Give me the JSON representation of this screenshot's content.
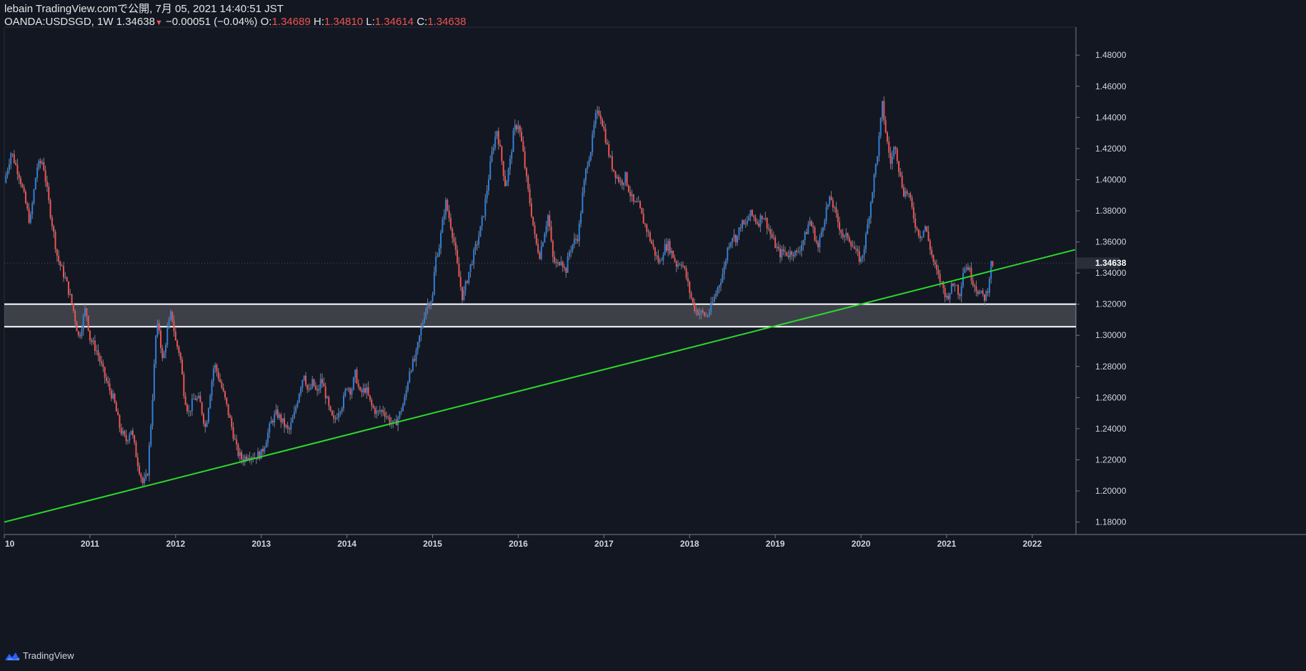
{
  "header": {
    "line1": "lebain TradingView.comで公開, 7月 05, 2021 14:40:51 JST",
    "symbol": "OANDA:USDSGD, 1W",
    "last": "1.34638",
    "change": "−0.00051 (−0.04%)",
    "o_label": "O:",
    "o_val": "1.34689",
    "h_label": "H:",
    "h_val": "1.34810",
    "l_label": "L:",
    "l_val": "1.34614",
    "c_label": "C:",
    "c_val": "1.34638"
  },
  "footer": {
    "brand": "TradingView"
  },
  "colors": {
    "up": "#2f7fd8",
    "down": "#ef5350",
    "trendline": "#2bd92b",
    "zone": "#ffffff",
    "background": "#131722"
  },
  "chart_data": {
    "type": "candlestick",
    "symbol": "OANDA:USDSGD",
    "interval": "1W",
    "y_ticks": [
      "1.18000",
      "1.20000",
      "1.22000",
      "1.24000",
      "1.26000",
      "1.28000",
      "1.30000",
      "1.32000",
      "1.34000",
      "1.36000",
      "1.38000",
      "1.40000",
      "1.42000",
      "1.44000",
      "1.46000",
      "1.48000"
    ],
    "ylim": [
      1.172,
      1.498
    ],
    "x_ticks": [
      "10",
      "2011",
      "2012",
      "2013",
      "2014",
      "2015",
      "2016",
      "2017",
      "2018",
      "2019",
      "2020",
      "2021",
      "2022"
    ],
    "x_tick_years": [
      2010.0,
      2011.0,
      2012.0,
      2013.0,
      2014.0,
      2015.0,
      2016.0,
      2017.0,
      2018.0,
      2019.0,
      2020.0,
      2021.0,
      2022.0
    ],
    "xlim": [
      2010.0,
      2022.51
    ],
    "price_label": "1.34638",
    "current_price": 1.34638,
    "zone": {
      "lower": 1.3055,
      "upper": 1.32
    },
    "trendline": [
      [
        2010.0,
        1.18
      ],
      [
        2022.5,
        1.355
      ]
    ],
    "close_path": [
      [
        2010.0,
        1.398
      ],
      [
        2010.08,
        1.418
      ],
      [
        2010.18,
        1.402
      ],
      [
        2010.3,
        1.372
      ],
      [
        2010.38,
        1.408
      ],
      [
        2010.45,
        1.412
      ],
      [
        2010.52,
        1.385
      ],
      [
        2010.62,
        1.35
      ],
      [
        2010.72,
        1.335
      ],
      [
        2010.8,
        1.318
      ],
      [
        2010.87,
        1.298
      ],
      [
        2010.95,
        1.318
      ],
      [
        2011.0,
        1.298
      ],
      [
        2011.08,
        1.29
      ],
      [
        2011.18,
        1.272
      ],
      [
        2011.28,
        1.258
      ],
      [
        2011.35,
        1.24
      ],
      [
        2011.42,
        1.232
      ],
      [
        2011.48,
        1.24
      ],
      [
        2011.55,
        1.22
      ],
      [
        2011.62,
        1.204
      ],
      [
        2011.67,
        1.21
      ],
      [
        2011.72,
        1.25
      ],
      [
        2011.77,
        1.3
      ],
      [
        2011.8,
        1.308
      ],
      [
        2011.85,
        1.282
      ],
      [
        2011.9,
        1.302
      ],
      [
        2011.95,
        1.315
      ],
      [
        2012.0,
        1.296
      ],
      [
        2012.05,
        1.288
      ],
      [
        2012.1,
        1.262
      ],
      [
        2012.15,
        1.25
      ],
      [
        2012.22,
        1.26
      ],
      [
        2012.28,
        1.258
      ],
      [
        2012.35,
        1.24
      ],
      [
        2012.4,
        1.262
      ],
      [
        2012.45,
        1.282
      ],
      [
        2012.52,
        1.27
      ],
      [
        2012.58,
        1.258
      ],
      [
        2012.65,
        1.242
      ],
      [
        2012.72,
        1.225
      ],
      [
        2012.78,
        1.22
      ],
      [
        2012.85,
        1.224
      ],
      [
        2012.92,
        1.222
      ],
      [
        2013.0,
        1.224
      ],
      [
        2013.05,
        1.232
      ],
      [
        2013.12,
        1.245
      ],
      [
        2013.18,
        1.25
      ],
      [
        2013.25,
        1.244
      ],
      [
        2013.32,
        1.238
      ],
      [
        2013.38,
        1.248
      ],
      [
        2013.45,
        1.266
      ],
      [
        2013.5,
        1.276
      ],
      [
        2013.55,
        1.262
      ],
      [
        2013.6,
        1.27
      ],
      [
        2013.65,
        1.262
      ],
      [
        2013.7,
        1.272
      ],
      [
        2013.75,
        1.262
      ],
      [
        2013.8,
        1.25
      ],
      [
        2013.85,
        1.244
      ],
      [
        2013.9,
        1.252
      ],
      [
        2013.95,
        1.256
      ],
      [
        2014.0,
        1.268
      ],
      [
        2014.05,
        1.264
      ],
      [
        2014.1,
        1.276
      ],
      [
        2014.15,
        1.262
      ],
      [
        2014.22,
        1.266
      ],
      [
        2014.28,
        1.255
      ],
      [
        2014.35,
        1.25
      ],
      [
        2014.42,
        1.252
      ],
      [
        2014.5,
        1.245
      ],
      [
        2014.55,
        1.242
      ],
      [
        2014.62,
        1.25
      ],
      [
        2014.68,
        1.26
      ],
      [
        2014.73,
        1.278
      ],
      [
        2014.8,
        1.285
      ],
      [
        2014.85,
        1.3
      ],
      [
        2014.92,
        1.318
      ],
      [
        2015.0,
        1.325
      ],
      [
        2015.03,
        1.348
      ],
      [
        2015.08,
        1.358
      ],
      [
        2015.15,
        1.386
      ],
      [
        2015.2,
        1.374
      ],
      [
        2015.25,
        1.36
      ],
      [
        2015.3,
        1.34
      ],
      [
        2015.35,
        1.324
      ],
      [
        2015.42,
        1.34
      ],
      [
        2015.48,
        1.352
      ],
      [
        2015.55,
        1.366
      ],
      [
        2015.6,
        1.38
      ],
      [
        2015.65,
        1.4
      ],
      [
        2015.7,
        1.42
      ],
      [
        2015.75,
        1.432
      ],
      [
        2015.8,
        1.415
      ],
      [
        2015.85,
        1.396
      ],
      [
        2015.9,
        1.41
      ],
      [
        2015.95,
        1.432
      ],
      [
        2016.0,
        1.436
      ],
      [
        2016.05,
        1.42
      ],
      [
        2016.1,
        1.398
      ],
      [
        2016.15,
        1.38
      ],
      [
        2016.2,
        1.36
      ],
      [
        2016.25,
        1.352
      ],
      [
        2016.3,
        1.365
      ],
      [
        2016.35,
        1.378
      ],
      [
        2016.4,
        1.35
      ],
      [
        2016.45,
        1.344
      ],
      [
        2016.5,
        1.35
      ],
      [
        2016.55,
        1.34
      ],
      [
        2016.6,
        1.355
      ],
      [
        2016.65,
        1.36
      ],
      [
        2016.7,
        1.364
      ],
      [
        2016.75,
        1.39
      ],
      [
        2016.8,
        1.41
      ],
      [
        2016.85,
        1.42
      ],
      [
        2016.9,
        1.44
      ],
      [
        2016.95,
        1.444
      ],
      [
        2017.0,
        1.432
      ],
      [
        2017.05,
        1.418
      ],
      [
        2017.1,
        1.408
      ],
      [
        2017.15,
        1.402
      ],
      [
        2017.2,
        1.398
      ],
      [
        2017.25,
        1.402
      ],
      [
        2017.3,
        1.392
      ],
      [
        2017.35,
        1.384
      ],
      [
        2017.4,
        1.384
      ],
      [
        2017.45,
        1.375
      ],
      [
        2017.5,
        1.368
      ],
      [
        2017.55,
        1.36
      ],
      [
        2017.6,
        1.352
      ],
      [
        2017.65,
        1.346
      ],
      [
        2017.7,
        1.356
      ],
      [
        2017.75,
        1.358
      ],
      [
        2017.8,
        1.352
      ],
      [
        2017.85,
        1.345
      ],
      [
        2017.9,
        1.348
      ],
      [
        2017.95,
        1.34
      ],
      [
        2018.0,
        1.328
      ],
      [
        2018.05,
        1.318
      ],
      [
        2018.1,
        1.315
      ],
      [
        2018.15,
        1.314
      ],
      [
        2018.2,
        1.312
      ],
      [
        2018.25,
        1.318
      ],
      [
        2018.3,
        1.326
      ],
      [
        2018.35,
        1.334
      ],
      [
        2018.4,
        1.342
      ],
      [
        2018.45,
        1.358
      ],
      [
        2018.5,
        1.364
      ],
      [
        2018.55,
        1.362
      ],
      [
        2018.6,
        1.372
      ],
      [
        2018.65,
        1.37
      ],
      [
        2018.7,
        1.378
      ],
      [
        2018.75,
        1.376
      ],
      [
        2018.8,
        1.372
      ],
      [
        2018.85,
        1.378
      ],
      [
        2018.9,
        1.372
      ],
      [
        2018.95,
        1.364
      ],
      [
        2019.0,
        1.358
      ],
      [
        2019.05,
        1.352
      ],
      [
        2019.1,
        1.354
      ],
      [
        2019.15,
        1.352
      ],
      [
        2019.2,
        1.354
      ],
      [
        2019.25,
        1.352
      ],
      [
        2019.3,
        1.358
      ],
      [
        2019.35,
        1.364
      ],
      [
        2019.4,
        1.374
      ],
      [
        2019.45,
        1.366
      ],
      [
        2019.5,
        1.356
      ],
      [
        2019.55,
        1.37
      ],
      [
        2019.6,
        1.382
      ],
      [
        2019.65,
        1.388
      ],
      [
        2019.7,
        1.378
      ],
      [
        2019.75,
        1.37
      ],
      [
        2019.8,
        1.362
      ],
      [
        2019.85,
        1.364
      ],
      [
        2019.9,
        1.358
      ],
      [
        2019.95,
        1.352
      ],
      [
        2020.0,
        1.348
      ],
      [
        2020.05,
        1.36
      ],
      [
        2020.1,
        1.38
      ],
      [
        2020.15,
        1.4
      ],
      [
        2020.2,
        1.42
      ],
      [
        2020.25,
        1.448
      ],
      [
        2020.3,
        1.426
      ],
      [
        2020.35,
        1.41
      ],
      [
        2020.4,
        1.424
      ],
      [
        2020.45,
        1.404
      ],
      [
        2020.5,
        1.392
      ],
      [
        2020.55,
        1.392
      ],
      [
        2020.6,
        1.38
      ],
      [
        2020.65,
        1.368
      ],
      [
        2020.7,
        1.364
      ],
      [
        2020.75,
        1.37
      ],
      [
        2020.8,
        1.358
      ],
      [
        2020.85,
        1.346
      ],
      [
        2020.9,
        1.338
      ],
      [
        2020.95,
        1.332
      ],
      [
        2021.0,
        1.324
      ],
      [
        2021.05,
        1.33
      ],
      [
        2021.1,
        1.334
      ],
      [
        2021.15,
        1.326
      ],
      [
        2021.2,
        1.344
      ],
      [
        2021.25,
        1.344
      ],
      [
        2021.3,
        1.336
      ],
      [
        2021.35,
        1.33
      ],
      [
        2021.4,
        1.326
      ],
      [
        2021.45,
        1.324
      ],
      [
        2021.48,
        1.33
      ],
      [
        2021.52,
        1.346
      ],
      [
        2021.55,
        1.346
      ]
    ]
  }
}
